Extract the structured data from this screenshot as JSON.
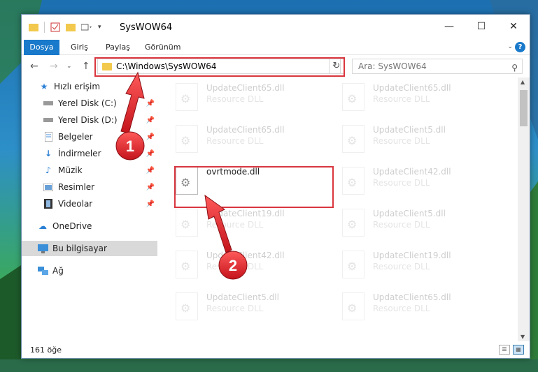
{
  "window": {
    "title": "SysWOW64",
    "minimize_glyph": "—",
    "maximize_glyph": "☐",
    "close_glyph": "✕"
  },
  "ribbon": {
    "tabs": [
      "Dosya",
      "Giriş",
      "Paylaş",
      "Görünüm"
    ],
    "help_label": "?"
  },
  "address": {
    "path": "C:\\Windows\\SysWOW64",
    "search_placeholder": "Ara: SysWOW64"
  },
  "sidebar": {
    "items": [
      {
        "label": "Hızlı erişim",
        "icon": "star-icon",
        "pinned": false
      },
      {
        "label": "Yerel Disk (C:)",
        "icon": "drive-icon",
        "pinned": true
      },
      {
        "label": "Yerel Disk (D:)",
        "icon": "drive-icon",
        "pinned": true
      },
      {
        "label": "Belgeler",
        "icon": "documents-icon",
        "pinned": true
      },
      {
        "label": "İndirmeler",
        "icon": "download-icon",
        "pinned": true
      },
      {
        "label": "Müzik",
        "icon": "music-icon",
        "pinned": true
      },
      {
        "label": "Resimler",
        "icon": "pictures-icon",
        "pinned": true
      },
      {
        "label": "Videolar",
        "icon": "video-icon",
        "pinned": true
      },
      {
        "label": "OneDrive",
        "icon": "cloud-icon",
        "pinned": false
      },
      {
        "label": "Bu bilgisayar",
        "icon": "computer-icon",
        "pinned": false,
        "selected": true
      },
      {
        "label": "Ağ",
        "icon": "network-icon",
        "pinned": false
      }
    ]
  },
  "files": [
    {
      "name": "UpdateClient65.dll",
      "type": "Resource DLL",
      "faded": true
    },
    {
      "name": "UpdateClient65.dll",
      "type": "Resource DLL",
      "faded": true
    },
    {
      "name": "UpdateClient65.dll",
      "type": "Resource DLL",
      "faded": true
    },
    {
      "name": "UpdateClient5.dll",
      "type": "Resource DLL",
      "faded": true
    },
    {
      "name": "ovrtmode.dll",
      "type": "",
      "faded": false
    },
    {
      "name": "UpdateClient42.dll",
      "type": "Resource DLL",
      "faded": true
    },
    {
      "name": "UpdateClient19.dll",
      "type": "Resource DLL",
      "faded": true
    },
    {
      "name": "UpdateClient5.dll",
      "type": "Resource DLL",
      "faded": true
    },
    {
      "name": "UpdateClient42.dll",
      "type": "Resource DLL",
      "faded": true
    },
    {
      "name": "UpdateClient19.dll",
      "type": "Resource DLL",
      "faded": true
    },
    {
      "name": "UpdateClient5.dll",
      "type": "Resource DLL",
      "faded": true
    },
    {
      "name": "UpdateClient65.dll",
      "type": "Resource DLL",
      "faded": true
    }
  ],
  "annotations": {
    "step1": "1",
    "step2": "2",
    "highlight_color": "#d9363e"
  },
  "status": {
    "item_count": "161 öğe"
  },
  "colors": {
    "accent": "#1979ca",
    "folder": "#f2c94c"
  }
}
